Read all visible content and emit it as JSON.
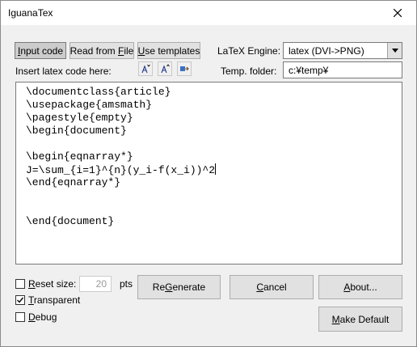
{
  "window": {
    "title": "IguanaTex"
  },
  "tabs": {
    "input_code": {
      "pre": "",
      "key": "I",
      "post": "nput code"
    },
    "read_from_file": {
      "pre": "Read from ",
      "key": "F",
      "post": "ile"
    },
    "use_templates": {
      "pre": "",
      "key": "U",
      "post": "se templates"
    }
  },
  "engine": {
    "label": "LaTeX Engine:",
    "value": "latex (DVI->PNG)"
  },
  "insert": {
    "label": "Insert latex code here:",
    "icons": [
      "font-size-increase-icon",
      "font-size-decrease-icon",
      "wrap-icon"
    ]
  },
  "temp": {
    "label": "Temp. folder:",
    "value": "c:¥temp¥"
  },
  "editor": {
    "lines": [
      "\\documentclass{article}",
      "\\usepackage{amsmath}",
      "\\pagestyle{empty}",
      "\\begin{document}",
      "",
      "\\begin{eqnarray*}",
      "J=\\sum_{i=1}^{n}(y_i-f(x_i))^2",
      "\\end{eqnarray*}",
      "",
      "",
      "\\end{document}"
    ]
  },
  "options": {
    "reset_size": {
      "pre": "",
      "key": "R",
      "post": "eset size:",
      "checked": false,
      "value": "20",
      "unit": "pts"
    },
    "transparent": {
      "pre": "",
      "key": "T",
      "post": "ransparent",
      "checked": true
    },
    "debug": {
      "pre": "",
      "key": "D",
      "post": "ebug",
      "checked": false
    }
  },
  "buttons": {
    "regenerate": {
      "pre": "Re",
      "key": "G",
      "post": "enerate"
    },
    "cancel": {
      "pre": "",
      "key": "C",
      "post": "ancel"
    },
    "about": {
      "pre": "",
      "key": "A",
      "post": "bout..."
    },
    "make_default": {
      "pre": "",
      "key": "M",
      "post": "ake Default"
    }
  }
}
